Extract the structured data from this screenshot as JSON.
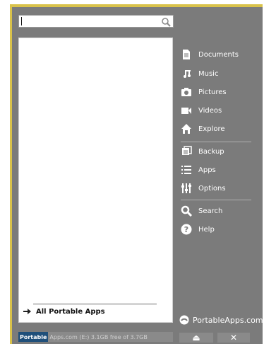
{
  "search": {
    "value": ""
  },
  "list": {
    "all_apps_label": "All Portable Apps"
  },
  "nav": {
    "items": [
      {
        "label": "Documents",
        "icon": "document-icon"
      },
      {
        "label": "Music",
        "icon": "music-icon"
      },
      {
        "label": "Pictures",
        "icon": "camera-icon"
      },
      {
        "label": "Videos",
        "icon": "video-icon"
      },
      {
        "label": "Explore",
        "icon": "home-icon"
      },
      {
        "label": "Backup",
        "icon": "backup-icon"
      },
      {
        "label": "Apps",
        "icon": "list-icon"
      },
      {
        "label": "Options",
        "icon": "options-icon"
      },
      {
        "label": "Search",
        "icon": "search-icon"
      },
      {
        "label": "Help",
        "icon": "help-icon"
      }
    ]
  },
  "footer": {
    "website_label": "PortableApps.com",
    "status_brand": "Portable",
    "status_rest": "Apps.com (E:) 3.1GB free of 3.7GB",
    "eject_symbol": "⏏",
    "close_symbol": "✕"
  },
  "colors": {
    "menu_bg": "#7b7b7b",
    "frame_accent": "#d9c24a",
    "brand_blue": "#1f4f7a"
  }
}
